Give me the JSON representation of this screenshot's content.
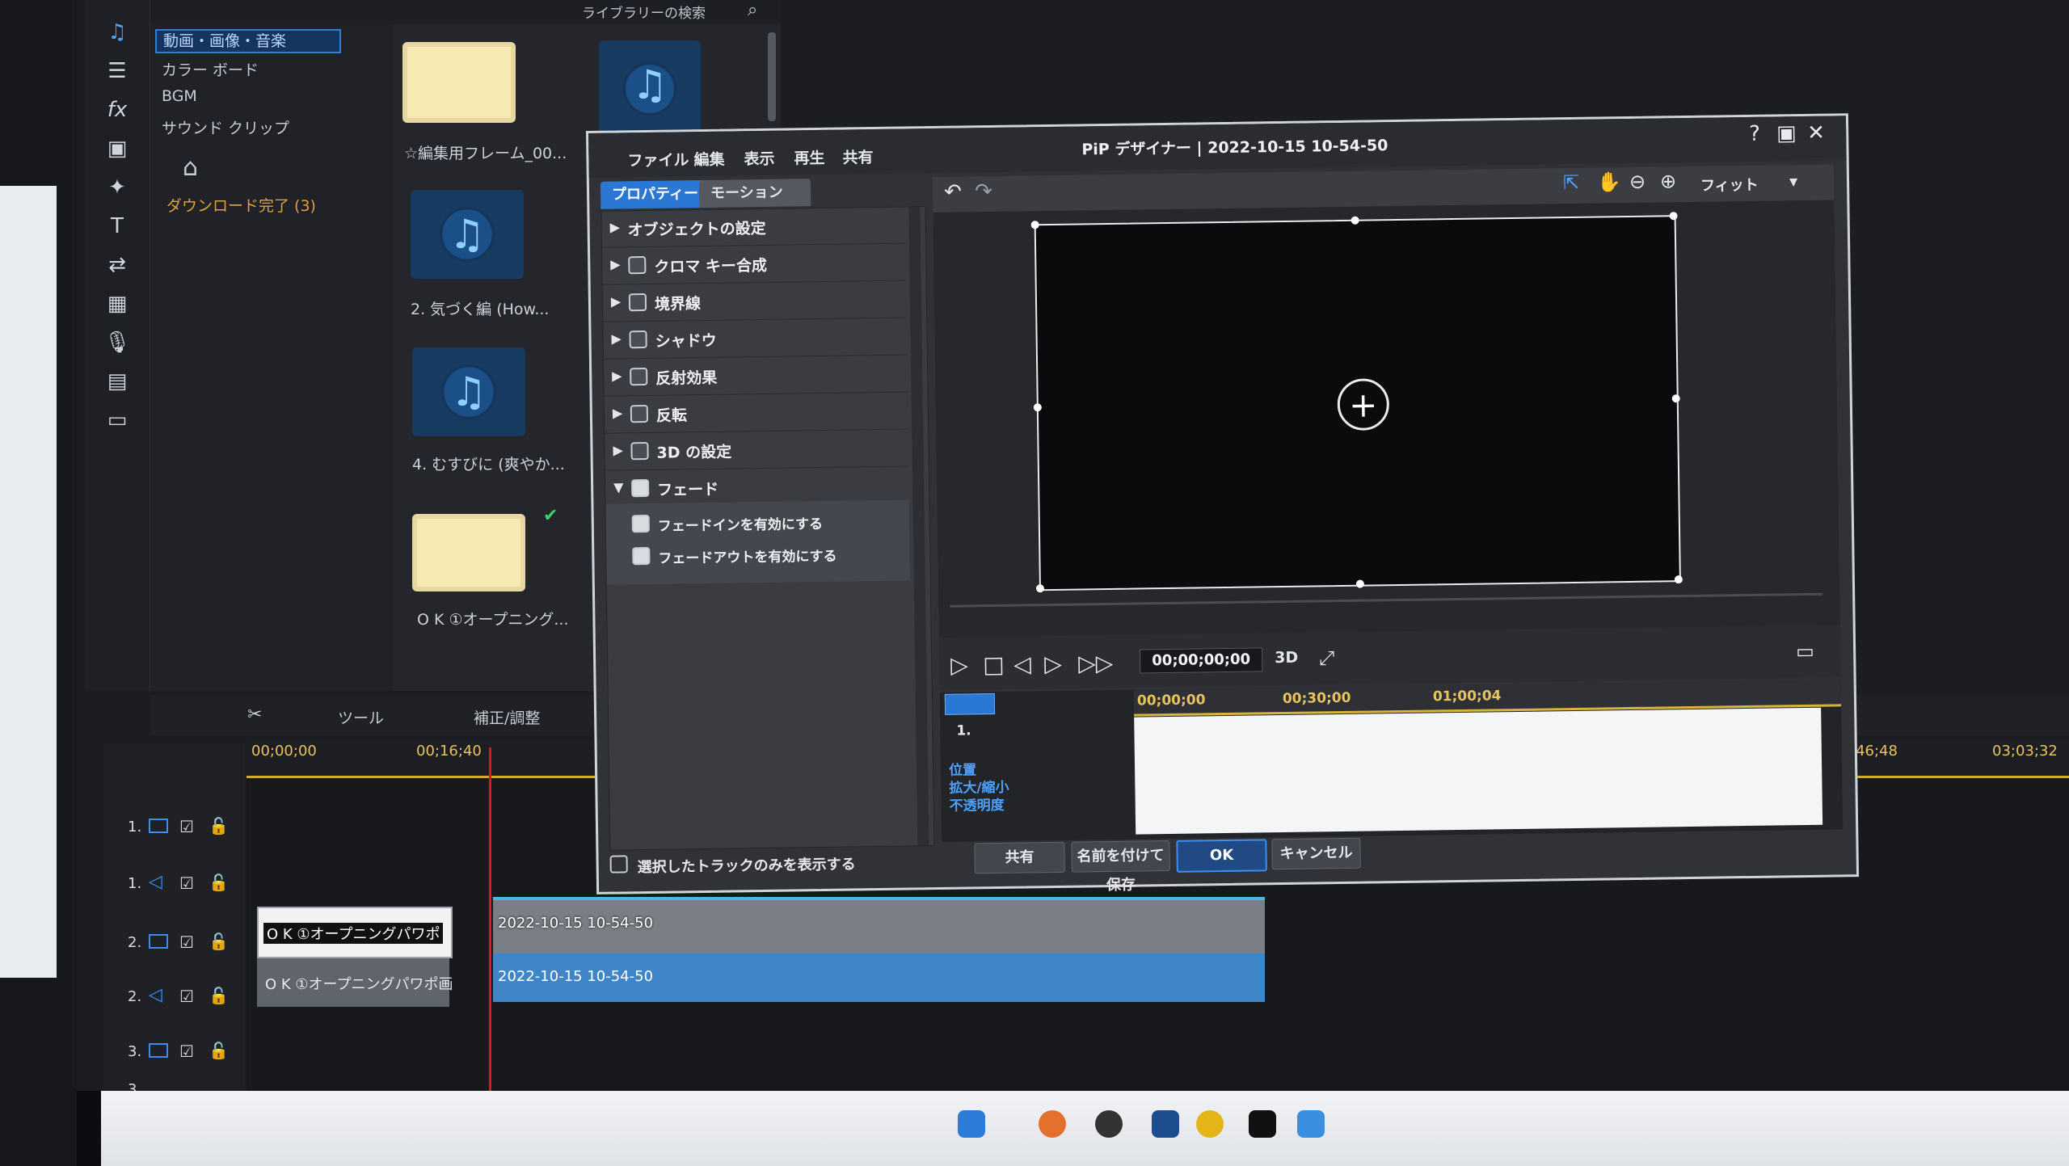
{
  "library": {
    "search_placeholder": "ライブラリーの検索",
    "categories": [
      "動画・画像・音楽",
      "カラー ボード",
      "BGM",
      "サウンド クリップ"
    ],
    "download_status": "ダウンロード完了 (3)",
    "items": [
      {
        "label": "☆編集用フレーム_00..."
      },
      {
        "label": "2. 気づく編 (How..."
      },
      {
        "label": "4. むすびに (爽やか..."
      },
      {
        "label": "O K ①オープニング..."
      }
    ]
  },
  "timeline": {
    "tool_label": "ツール",
    "fix_label": "補正/調整",
    "ruler": [
      "00;00;00",
      "00;16;40",
      ";46;48",
      "03;03;32"
    ],
    "tracks": [
      {
        "num": "1."
      },
      {
        "num": "1."
      },
      {
        "num": "2."
      },
      {
        "num": "2."
      },
      {
        "num": "3."
      },
      {
        "num": "3."
      }
    ],
    "clips": {
      "title_video": "O K ①オープニングパワポ",
      "title_audio": "O K ①オープニングパワポ画",
      "video_name": "2022-10-15 10-54-50",
      "audio_name": "2022-10-15 10-54-50"
    }
  },
  "dialog": {
    "title": "PiP デザイナー | 2022-10-15 10-54-50",
    "menus": [
      "ファイル",
      "編集",
      "表示",
      "再生",
      "共有"
    ],
    "tabs": [
      "プロパティー",
      "モーション"
    ],
    "properties": [
      {
        "label": "オブジェクトの設定",
        "checkbox": false,
        "expanded": false
      },
      {
        "label": "クロマ キー合成",
        "checkbox": true,
        "expanded": false
      },
      {
        "label": "境界線",
        "checkbox": true,
        "expanded": false
      },
      {
        "label": "シャドウ",
        "checkbox": true,
        "expanded": false
      },
      {
        "label": "反射効果",
        "checkbox": true,
        "expanded": false
      },
      {
        "label": "反転",
        "checkbox": true,
        "expanded": false
      },
      {
        "label": "3D の設定",
        "checkbox": true,
        "expanded": false
      },
      {
        "label": "フェード",
        "checkbox": true,
        "expanded": true
      }
    ],
    "fade_options": [
      "フェードインを有効にする",
      "フェードアウトを有効にする"
    ],
    "only_selected_label": "選択したトラックのみを表示する",
    "zoom_fit": "フィット",
    "timecode": "00;00;00;00",
    "mode_3d": "3D",
    "kf_times": [
      "00;00;00",
      "00;30;00",
      "01;00;04"
    ],
    "kf_track_name": "1.",
    "kf_rows": [
      "位置",
      "拡大/縮小",
      "不透明度"
    ],
    "buttons": {
      "share": "共有",
      "save_as": "名前を付けて保存",
      "ok": "OK",
      "cancel": "キャンセル"
    }
  }
}
